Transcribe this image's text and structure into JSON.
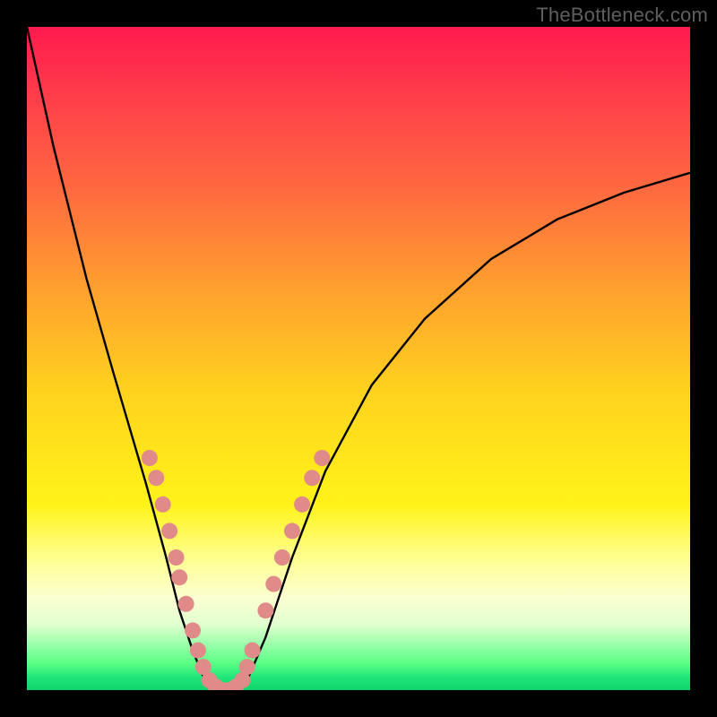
{
  "watermark": "TheBottleneck.com",
  "chart_data": {
    "type": "line",
    "title": "",
    "xlabel": "",
    "ylabel": "",
    "xlim": [
      0,
      100
    ],
    "ylim": [
      0,
      100
    ],
    "legend": false,
    "grid": false,
    "background_gradient": [
      "#ff1a4e",
      "#ff6b3f",
      "#ffd21e",
      "#ffff8f",
      "#0dd469"
    ],
    "series": [
      {
        "name": "bottleneck-curve",
        "color": "#000000",
        "x": [
          0,
          4,
          9,
          13,
          18,
          21,
          23,
          25,
          27,
          29,
          31,
          33,
          36,
          40,
          45,
          52,
          60,
          70,
          80,
          90,
          100
        ],
        "y": [
          100,
          82,
          62,
          48,
          31,
          20,
          12,
          6,
          1,
          0,
          0,
          1,
          8,
          20,
          33,
          46,
          56,
          65,
          71,
          75,
          78
        ]
      }
    ],
    "markers": [
      {
        "name": "sample-dots",
        "color": "#e08a8a",
        "radius": 9,
        "points": [
          {
            "x": 18.5,
            "y": 35
          },
          {
            "x": 19.5,
            "y": 32
          },
          {
            "x": 20.5,
            "y": 28
          },
          {
            "x": 21.5,
            "y": 24
          },
          {
            "x": 22.5,
            "y": 20
          },
          {
            "x": 23.0,
            "y": 17
          },
          {
            "x": 24.0,
            "y": 13
          },
          {
            "x": 25.0,
            "y": 9
          },
          {
            "x": 25.8,
            "y": 6
          },
          {
            "x": 26.6,
            "y": 3.5
          },
          {
            "x": 27.5,
            "y": 1.5
          },
          {
            "x": 28.5,
            "y": 0.5
          },
          {
            "x": 29.5,
            "y": 0
          },
          {
            "x": 30.5,
            "y": 0
          },
          {
            "x": 31.5,
            "y": 0.5
          },
          {
            "x": 32.5,
            "y": 1.5
          },
          {
            "x": 33.2,
            "y": 3.5
          },
          {
            "x": 34.0,
            "y": 6
          },
          {
            "x": 36.0,
            "y": 12
          },
          {
            "x": 37.2,
            "y": 16
          },
          {
            "x": 38.5,
            "y": 20
          },
          {
            "x": 40.0,
            "y": 24
          },
          {
            "x": 41.5,
            "y": 28
          },
          {
            "x": 43.0,
            "y": 32
          },
          {
            "x": 44.5,
            "y": 35
          }
        ]
      }
    ]
  }
}
